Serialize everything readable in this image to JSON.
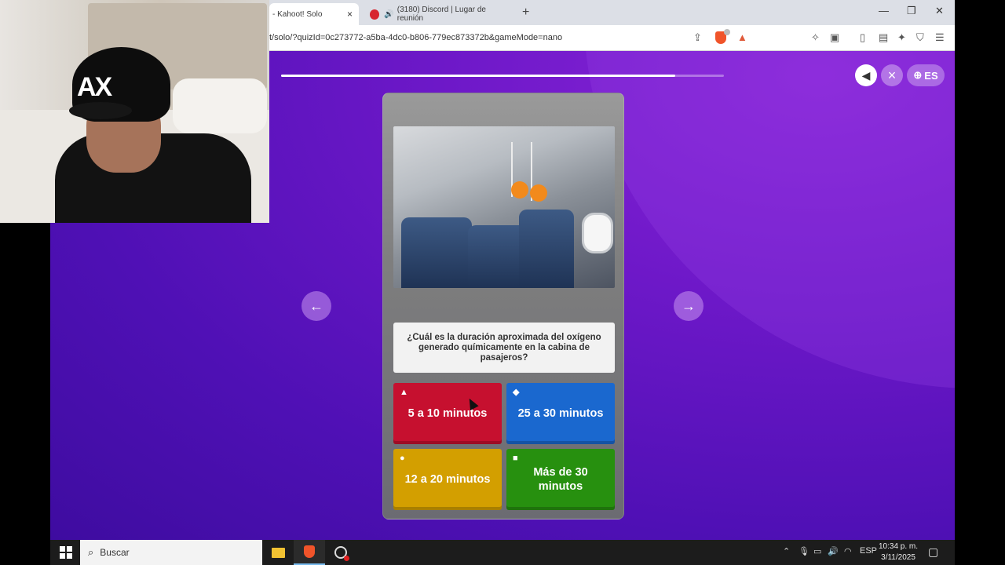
{
  "browser": {
    "tabs": [
      {
        "label": "- Kahoot! Solo",
        "close": "×"
      },
      {
        "label": "(3180) Discord | Lugar de reunión",
        "icon": "discord-icon"
      }
    ],
    "new_tab": "+",
    "url": "t/solo/?quizId=0c273772-a5ba-4dc0-b806-779ec873372b&gameMode=nano",
    "window_controls": [
      "—",
      "❐",
      "✕"
    ]
  },
  "quiz": {
    "progress": 0.89,
    "lang": "ES",
    "question": "¿Cuál es la duración aproximada del oxígeno generado químicamente en la cabina de pasajeros?",
    "answers": [
      {
        "shape": "▲",
        "text": "5 a 10 minutos",
        "color": "#c6102f"
      },
      {
        "shape": "◆",
        "text": "25 a 30 minutos",
        "color": "#1a68cf"
      },
      {
        "shape": "●",
        "text": "12 a 20 minutos",
        "color": "#d39f00"
      },
      {
        "shape": "■",
        "text": "Más de 30 minutos",
        "color": "#27900f"
      }
    ],
    "prev": "←",
    "next": "→"
  },
  "webcam": {
    "cap_text": "AX"
  },
  "taskbar": {
    "search_placeholder": "Buscar",
    "lang": "ESP",
    "time": "10:34 p. m.",
    "date": "3/11/2025"
  }
}
